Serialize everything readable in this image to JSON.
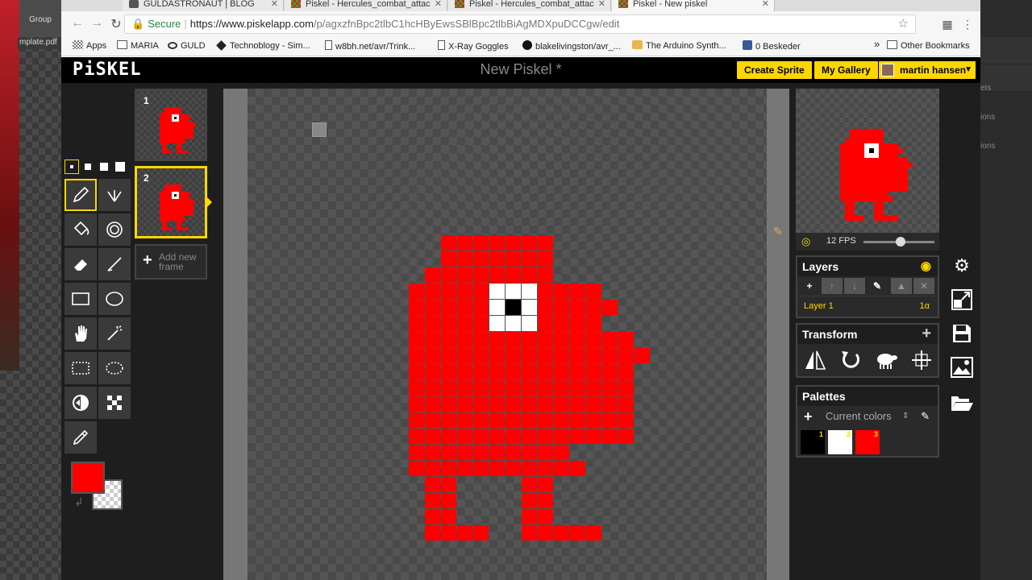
{
  "desktop": {
    "group_label": "Group",
    "file_label": "mplate.pdf",
    "right_items": [
      "ets",
      "ions",
      "ions"
    ]
  },
  "browser": {
    "tabs": [
      {
        "label": "GULDASTRONAUT | BLOG",
        "active": false
      },
      {
        "label": "Piskel - Hercules_combat_attac",
        "active": false
      },
      {
        "label": "Piskel - Hercules_combat_attac",
        "active": false
      },
      {
        "label": "Piskel - New piskel",
        "active": true
      }
    ],
    "url": {
      "secure_label": "Secure",
      "scheme_host": "https://www.piskelapp.com",
      "path": "/p/agxzfnBpc2tlbC1hcHByEwsSBlBpc2tlbBiAgMDXpuDCCgw/edit"
    },
    "bookmarks": [
      {
        "label": "Apps",
        "icon": "apps-icon"
      },
      {
        "label": "MARIA",
        "icon": "folder-icon"
      },
      {
        "label": "GULD",
        "icon": "guld-icon"
      },
      {
        "label": "Technoblogy - Sim...",
        "icon": "diamond-icon"
      },
      {
        "label": "w8bh.net/avr/Trink...",
        "icon": "document-icon"
      },
      {
        "label": "X-Ray Goggles",
        "icon": "document-icon"
      },
      {
        "label": "blakelivingston/avr_...",
        "icon": "github-icon"
      },
      {
        "label": "The Arduino Synth...",
        "icon": "arduino-icon"
      },
      {
        "label": "0 Beskeder",
        "icon": "facebook-icon"
      }
    ],
    "more_bookmarks": "»",
    "other_bookmarks": "Other Bookmarks"
  },
  "app": {
    "logo": "PiSKEL",
    "title": "New Piskel *",
    "create_sprite": "Create Sprite",
    "my_gallery": "My Gallery",
    "user_name": "martin hansen",
    "frames": [
      {
        "number": "1",
        "selected": false
      },
      {
        "number": "2",
        "selected": true
      }
    ],
    "add_frame_label": "Add new frame",
    "fps_label": "12 FPS",
    "fps_value": 12,
    "layers_title": "Layers",
    "layer_name": "Layer 1",
    "layer_opacity": "1α",
    "transform_title": "Transform",
    "palettes_title": "Palettes",
    "palette_name": "Current colors",
    "palette_colors": [
      {
        "n": "1",
        "color": "#000000"
      },
      {
        "n": "2",
        "color": "#ffffff"
      },
      {
        "n": "3",
        "color": "#ff0000"
      }
    ],
    "primary_color": "#ff0000",
    "secondary_color": "transparent",
    "accent": "#ffd700"
  },
  "sprite": {
    "rows": [
      "..#######",
      "..#######",
      ".########",
      "#####WWW####",
      "#####WBW#####",
      "#####WWW####",
      "##############",
      "###############",
      "##############",
      "##############",
      "##############",
      "##############",
      "##############",
      "##########",
      "###########",
      ".##....##",
      ".##....##",
      ".##....##",
      ".####..#####"
    ]
  }
}
